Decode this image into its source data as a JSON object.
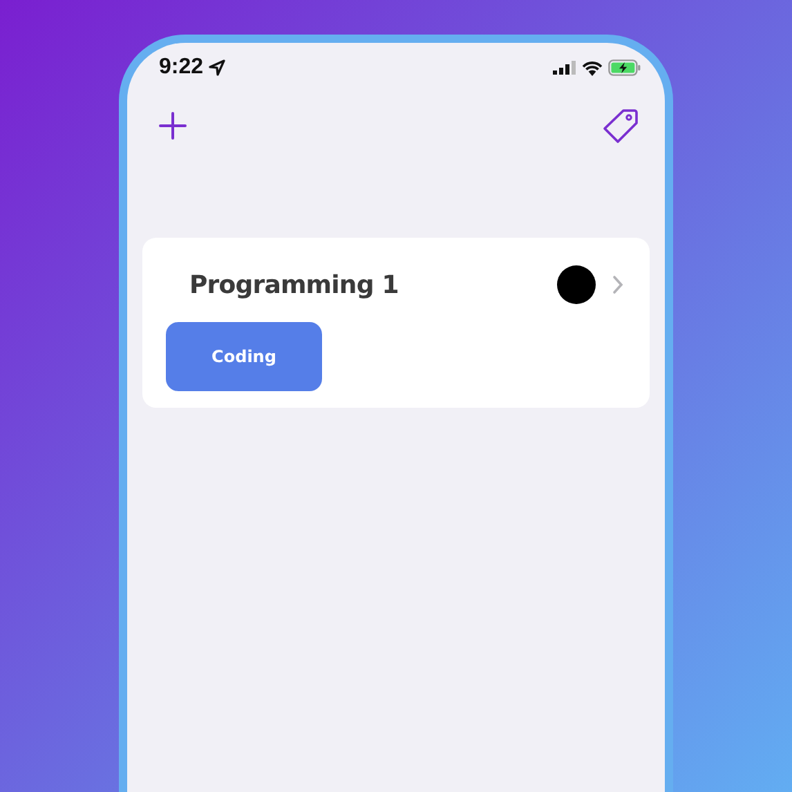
{
  "status_bar": {
    "time": "9:22"
  },
  "lists": [
    {
      "title": "Programming 1",
      "color": "#000000",
      "tags": [
        {
          "label": "Coding",
          "color": "#557ee8"
        }
      ]
    }
  ]
}
